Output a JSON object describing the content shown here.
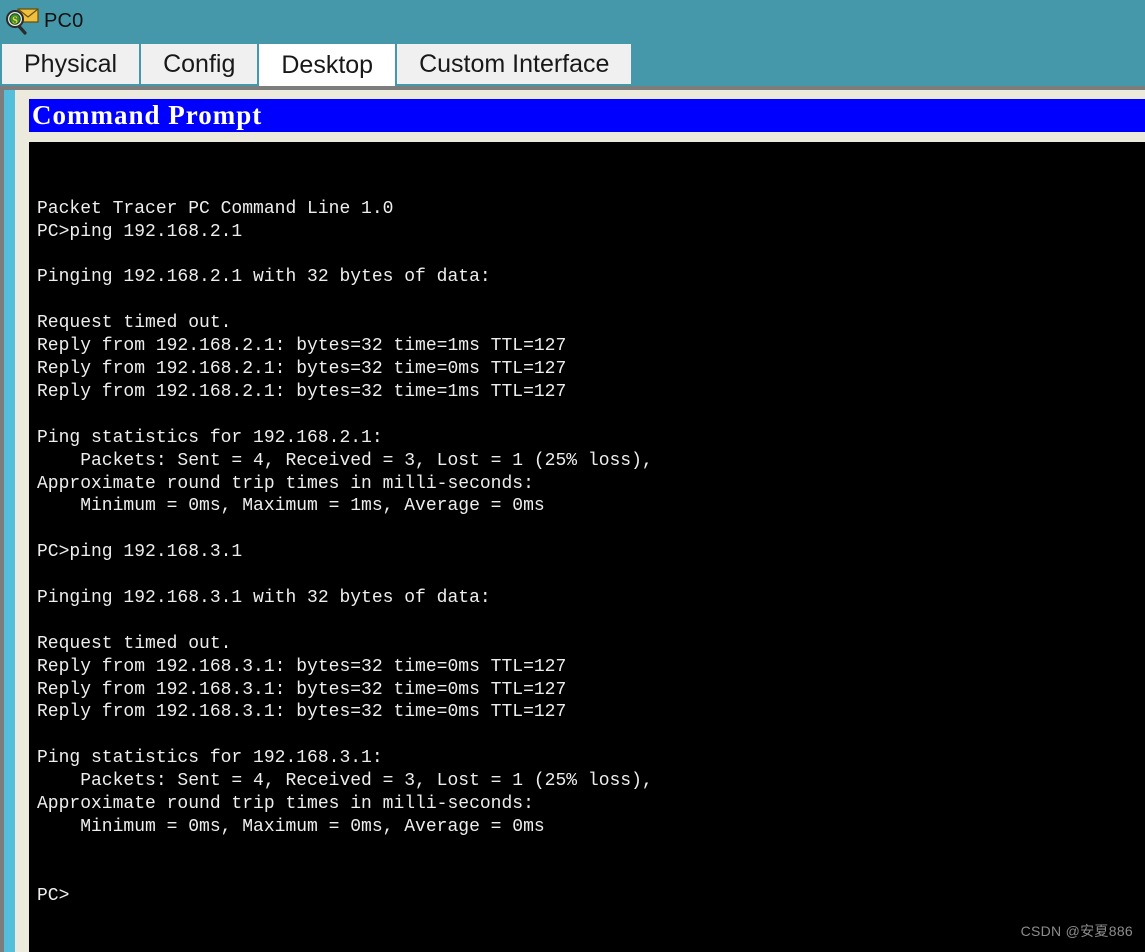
{
  "window": {
    "title": "PC0",
    "icon": "inspect-envelope-icon"
  },
  "tabs": [
    {
      "label": "Physical",
      "active": false
    },
    {
      "label": "Config",
      "active": false
    },
    {
      "label": "Desktop",
      "active": true
    },
    {
      "label": "Custom Interface",
      "active": false
    }
  ],
  "command_prompt": {
    "header": "Command Prompt",
    "header_bg": "#0000ff",
    "header_fg": "#ffffff",
    "terminal_bg": "#000000",
    "terminal_fg": "#eeeeee",
    "lines": [
      "Packet Tracer PC Command Line 1.0",
      "PC>ping 192.168.2.1",
      "",
      "Pinging 192.168.2.1 with 32 bytes of data:",
      "",
      "Request timed out.",
      "Reply from 192.168.2.1: bytes=32 time=1ms TTL=127",
      "Reply from 192.168.2.1: bytes=32 time=0ms TTL=127",
      "Reply from 192.168.2.1: bytes=32 time=1ms TTL=127",
      "",
      "Ping statistics for 192.168.2.1:",
      "    Packets: Sent = 4, Received = 3, Lost = 1 (25% loss),",
      "Approximate round trip times in milli-seconds:",
      "    Minimum = 0ms, Maximum = 1ms, Average = 0ms",
      "",
      "PC>ping 192.168.3.1",
      "",
      "Pinging 192.168.3.1 with 32 bytes of data:",
      "",
      "Request timed out.",
      "Reply from 192.168.3.1: bytes=32 time=0ms TTL=127",
      "Reply from 192.168.3.1: bytes=32 time=0ms TTL=127",
      "Reply from 192.168.3.1: bytes=32 time=0ms TTL=127",
      "",
      "Ping statistics for 192.168.3.1:",
      "    Packets: Sent = 4, Received = 3, Lost = 1 (25% loss),",
      "Approximate round trip times in milli-seconds:",
      "    Minimum = 0ms, Maximum = 0ms, Average = 0ms",
      "",
      "",
      "PC>"
    ]
  },
  "watermark": "CSDN @安夏886",
  "colors": {
    "titlebar": "#4597aa",
    "panel_frame": "#7d7d7d",
    "panel_teal": "#55bedb",
    "panel_beige": "#eceadd",
    "tab_inactive": "#f0f0f0",
    "tab_active": "#ffffff"
  }
}
